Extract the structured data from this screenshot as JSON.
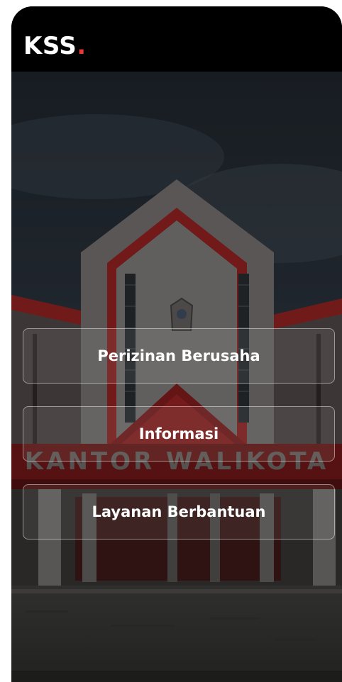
{
  "app": {
    "logo_text": "KSS",
    "logo_dot": ".",
    "accent_color": "#e53935"
  },
  "background": {
    "sign_text": "KANTOR WALIKOTA",
    "description_icon": "city-hall-building-photo"
  },
  "menu": {
    "items": [
      {
        "label": "Perizinan Berusaha"
      },
      {
        "label": "Informasi"
      },
      {
        "label": "Layanan Berbantuan"
      }
    ]
  }
}
